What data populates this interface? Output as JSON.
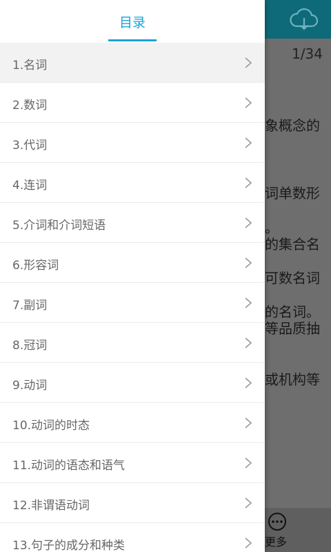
{
  "background": {
    "page_indicator": "1/34",
    "text_fragments": [
      "象概念的",
      "词单数形",
      "。",
      "的集合名",
      "可数名词",
      "的名词。",
      "等品质抽",
      "或机构等"
    ],
    "more_label": "更多",
    "icons": {
      "cloud": "cloud-download-icon",
      "more": "more-dots-icon"
    }
  },
  "drawer": {
    "title": "目录",
    "items": [
      {
        "label": "1.名词"
      },
      {
        "label": "2.数词"
      },
      {
        "label": "3.代词"
      },
      {
        "label": "4.连词"
      },
      {
        "label": "5.介词和介词短语"
      },
      {
        "label": "6.形容词"
      },
      {
        "label": "7.副词"
      },
      {
        "label": "8.冠词"
      },
      {
        "label": "9.动词"
      },
      {
        "label": "10.动词的时态"
      },
      {
        "label": "11.动词的语态和语气"
      },
      {
        "label": "12.非谓语动词"
      },
      {
        "label": "13.句子的成分和种类"
      }
    ]
  },
  "colors": {
    "accent": "#1aa3d6",
    "header_bg": "#0e6a78"
  }
}
